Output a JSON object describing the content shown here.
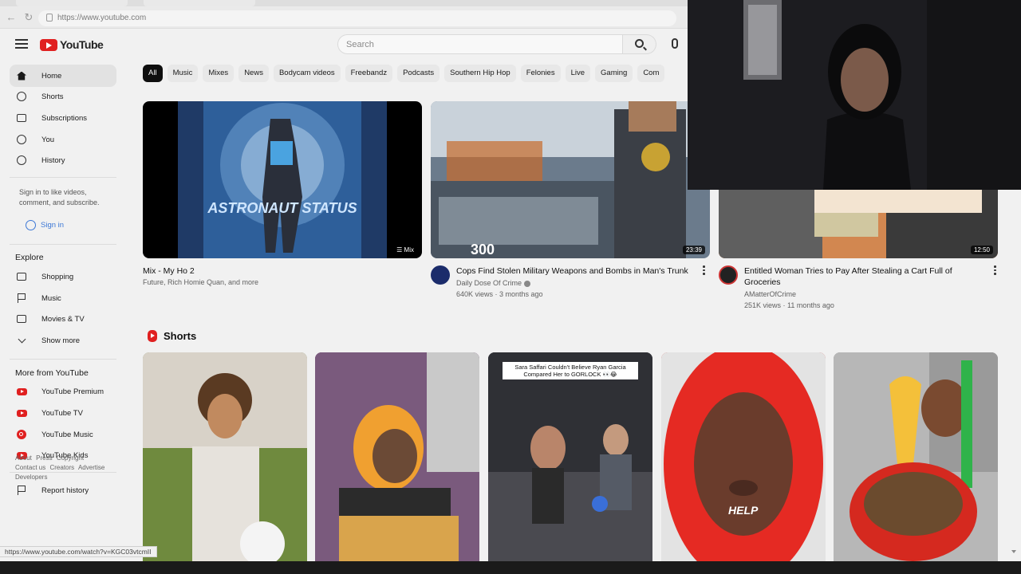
{
  "browser": {
    "url": "https://www.youtube.com",
    "status_url": "https://www.youtube.com/watch?v=KGC03vtcmII"
  },
  "header": {
    "logo_text": "YouTube",
    "search_placeholder": "Search",
    "menu_icon": "hamburger-icon",
    "search_icon": "magnifier-icon",
    "mic_icon": "microphone-icon"
  },
  "sidebar": {
    "main": [
      {
        "label": "Home",
        "icon": "home-icon",
        "active": true
      },
      {
        "label": "Shorts",
        "icon": "shorts-icon"
      },
      {
        "label": "Subscriptions",
        "icon": "subscriptions-icon"
      },
      {
        "label": "You",
        "icon": "you-icon"
      },
      {
        "label": "History",
        "icon": "history-icon"
      }
    ],
    "signin_prompt": "Sign in to like videos, comment, and subscribe.",
    "signin_label": "Sign in",
    "explore_heading": "Explore",
    "explore": [
      {
        "label": "Shopping",
        "icon": "shopping-icon"
      },
      {
        "label": "Music",
        "icon": "music-icon"
      },
      {
        "label": "Movies & TV",
        "icon": "movies-icon"
      },
      {
        "label": "Show more",
        "icon": "chevron-down-icon"
      }
    ],
    "more_heading": "More from YouTube",
    "more": [
      {
        "label": "YouTube Premium",
        "icon": "youtube-premium-icon"
      },
      {
        "label": "YouTube TV",
        "icon": "youtube-tv-icon"
      },
      {
        "label": "YouTube Music",
        "icon": "youtube-music-icon"
      },
      {
        "label": "YouTube Kids",
        "icon": "youtube-kids-icon"
      }
    ],
    "report_label": "Report history",
    "footer": [
      "About",
      "Press",
      "Copyright",
      "Contact us",
      "Creators",
      "Advertise",
      "Developers"
    ]
  },
  "chips": [
    "All",
    "Music",
    "Mixes",
    "News",
    "Bodycam videos",
    "Freebandz",
    "Podcasts",
    "Southern Hip Hop",
    "Felonies",
    "Live",
    "Gaming",
    "Com"
  ],
  "videos": [
    {
      "title": "Mix - My Ho 2",
      "channel": "Future, Rich Homie Quan, and more",
      "badge": "Mix",
      "thumb_text": "ASTRONAUT STATUS"
    },
    {
      "title": "Cops Find Stolen Military Weapons and Bombs in Man's Trunk",
      "channel": "Daily Dose Of Crime",
      "stats": "640K views · 3 months ago",
      "badge": "23:39"
    },
    {
      "title": "Entitled Woman Tries to Pay After Stealing a Cart Full of Groceries",
      "channel": "AMatterOfCrime",
      "stats": "251K views · 11 months ago",
      "badge": "12:50"
    }
  ],
  "shorts": {
    "heading": "Shorts",
    "items": [
      {
        "caption": ""
      },
      {
        "caption": ""
      },
      {
        "caption": "Sara Saffari Couldn't Believe Ryan Garcia Compared Her to GORLOCK 👀😂"
      },
      {
        "caption": "",
        "overlay": "HELP"
      },
      {
        "caption": ""
      }
    ]
  }
}
